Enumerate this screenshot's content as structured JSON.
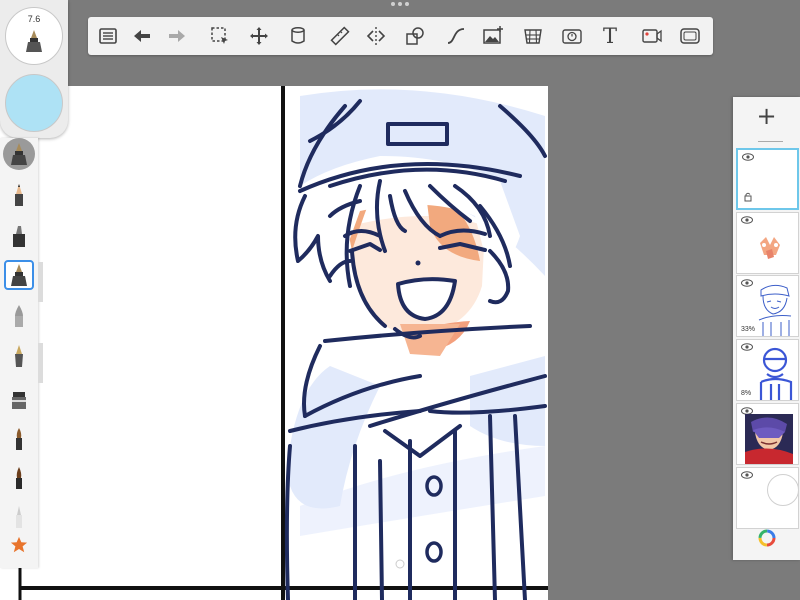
{
  "brush_panel": {
    "size_value": "7.6",
    "current_color": "#aee2f5",
    "tools": [
      {
        "name": "pencil-icon"
      },
      {
        "name": "marker-icon"
      },
      {
        "name": "ink-pen-icon",
        "selected": true
      },
      {
        "name": "airbrush-icon"
      },
      {
        "name": "fountain-pen-icon"
      },
      {
        "name": "flat-brush-icon"
      },
      {
        "name": "paint-brush-icon"
      },
      {
        "name": "fine-brush-icon"
      },
      {
        "name": "eraser-brush-icon"
      },
      {
        "name": "favorites-star-icon"
      }
    ]
  },
  "toolbar": {
    "tools": [
      "list-icon",
      "undo-icon",
      "redo-icon",
      "selection-icon",
      "transform-icon",
      "fill-icon",
      "ruler-icon",
      "symmetry-icon",
      "shapes-icon",
      "curve-icon",
      "import-image-icon",
      "perspective-icon",
      "time-lapse-icon",
      "text-tool-icon",
      "video-icon",
      "fullscreen-icon"
    ],
    "text_label": "T"
  },
  "layers": {
    "add_label": "+",
    "items": [
      {
        "name": "layer-empty-active",
        "opacity": ""
      },
      {
        "name": "layer-color-blocks",
        "opacity": ""
      },
      {
        "name": "layer-line-sketch",
        "opacity": "33%"
      },
      {
        "name": "layer-rough-sketch",
        "opacity": "8%"
      },
      {
        "name": "layer-reference-image",
        "opacity": ""
      },
      {
        "name": "layer-background",
        "opacity": ""
      }
    ]
  },
  "colors": {
    "canvas_bg": "#7b7b7b",
    "accent_selected": "#3c8fe8",
    "active_layer_border": "#6ec7ea",
    "line_art": "#1f2b5e",
    "skin_shadow": "#f3b089"
  }
}
